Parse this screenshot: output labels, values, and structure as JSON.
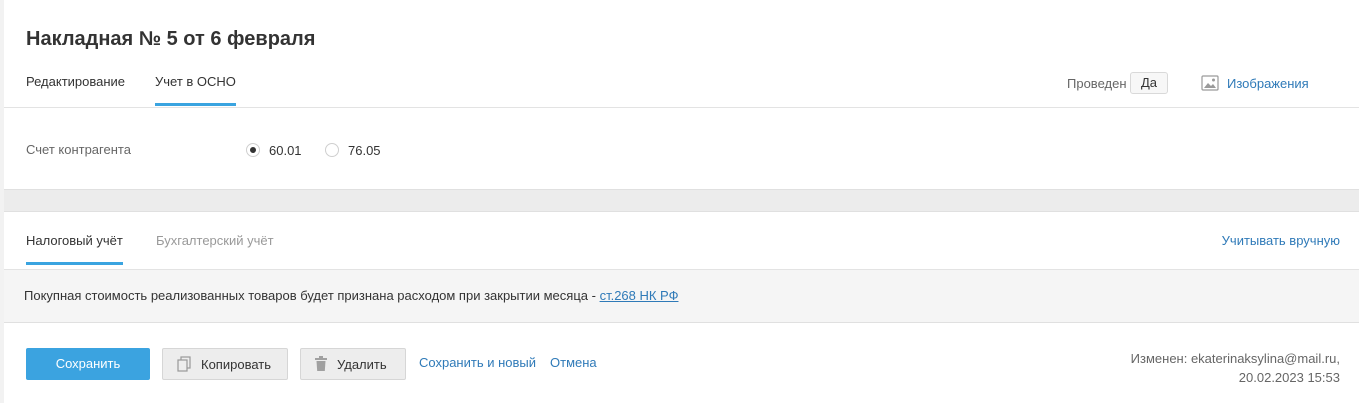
{
  "document": {
    "title": "Накладная № 5 от 6 февраля"
  },
  "top_tabs": [
    {
      "label": "Редактирование",
      "active": false
    },
    {
      "label": "Учет в ОСНО",
      "active": true
    }
  ],
  "status": {
    "posted_label": "Проведен",
    "posted_value": "Да"
  },
  "images": {
    "label": "Изображения",
    "icon": "image-icon"
  },
  "counterparty_account": {
    "label": "Счет контрагента",
    "options": [
      {
        "label": "60.01",
        "selected": true
      },
      {
        "label": "76.05",
        "selected": false
      }
    ]
  },
  "accounting_tabs": [
    {
      "label": "Налоговый учёт",
      "active": true
    },
    {
      "label": "Бухгалтерский учёт",
      "active": false
    }
  ],
  "manual_link": "Учитывать вручную",
  "notice": {
    "text": "Покупная стоимость реализованных товаров будет признана расходом при закрытии месяца - ",
    "link": "ст.268 НК РФ"
  },
  "actions": {
    "save": "Сохранить",
    "copy": "Копировать",
    "delete": "Удалить",
    "save_new": "Сохранить и новый",
    "cancel": "Отмена"
  },
  "modified": {
    "line1": "Изменен: ekaterinaksylina@mail.ru,",
    "line2": "20.02.2023 15:53"
  },
  "colors": {
    "accent": "#3ba3e0",
    "link": "#2f7ab8"
  }
}
